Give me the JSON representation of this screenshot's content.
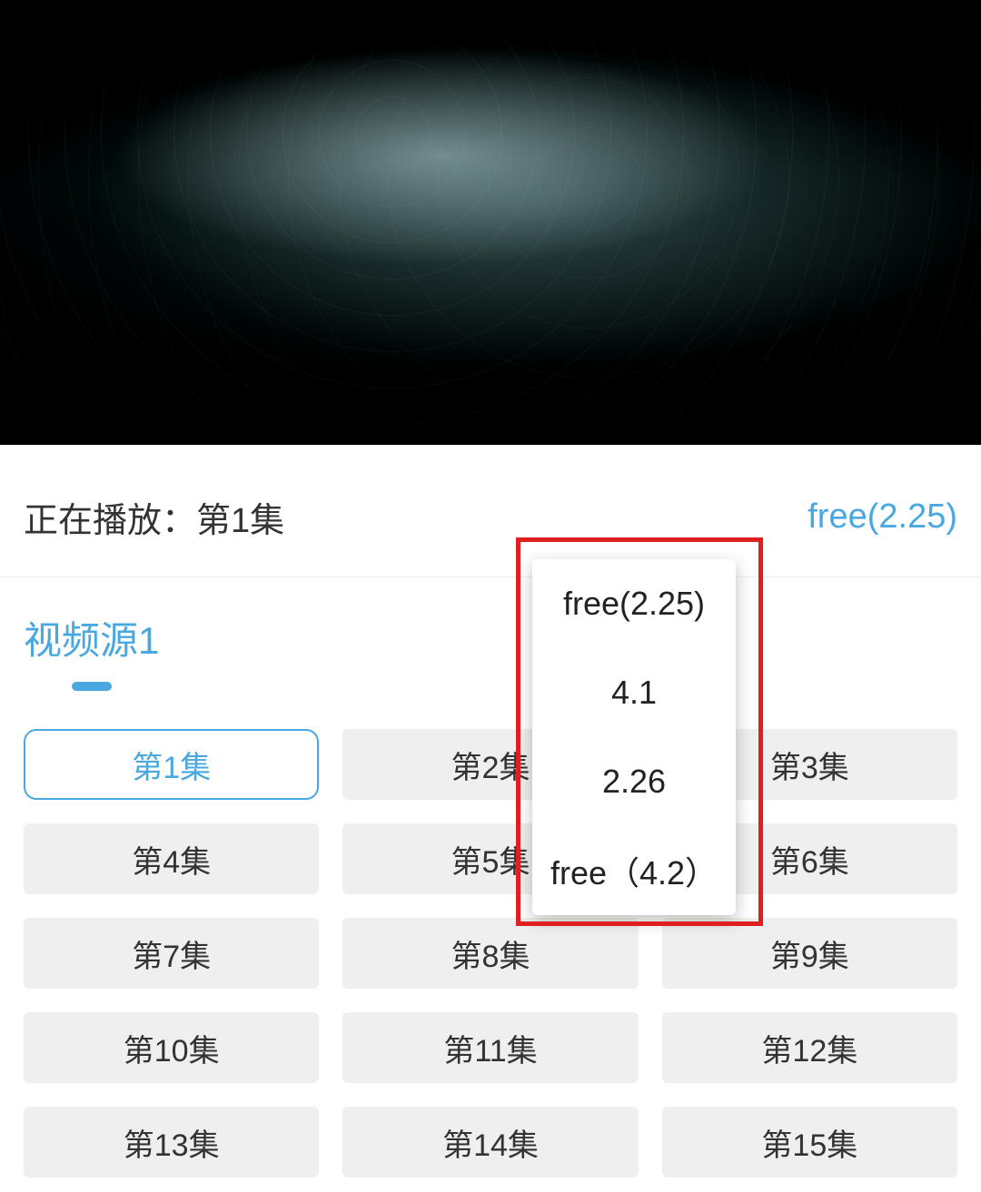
{
  "colors": {
    "accent": "#4aa8e0",
    "highlight": "#e02020"
  },
  "info": {
    "now_playing_label": "正在播放：第1集",
    "source_current": "free(2.25)"
  },
  "tabs": {
    "source_tab_label": "视频源1"
  },
  "episodes": [
    {
      "label": "第1集",
      "active": true
    },
    {
      "label": "第2集",
      "active": false
    },
    {
      "label": "第3集",
      "active": false
    },
    {
      "label": "第4集",
      "active": false
    },
    {
      "label": "第5集",
      "active": false
    },
    {
      "label": "第6集",
      "active": false
    },
    {
      "label": "第7集",
      "active": false
    },
    {
      "label": "第8集",
      "active": false
    },
    {
      "label": "第9集",
      "active": false
    },
    {
      "label": "第10集",
      "active": false
    },
    {
      "label": "第11集",
      "active": false
    },
    {
      "label": "第12集",
      "active": false
    },
    {
      "label": "第13集",
      "active": false
    },
    {
      "label": "第14集",
      "active": false
    },
    {
      "label": "第15集",
      "active": false
    }
  ],
  "source_dropdown": {
    "options": [
      "free(2.25)",
      "4.1",
      "2.26",
      "free（4.2）"
    ]
  }
}
